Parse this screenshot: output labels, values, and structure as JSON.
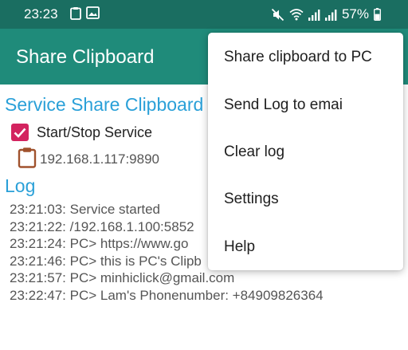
{
  "status_bar": {
    "time": "23:23",
    "battery": "57%",
    "icons": [
      "clipboard-icon",
      "image-icon",
      "mute-icon",
      "wifi-icon",
      "signal-icon",
      "signal-icon",
      "battery-icon"
    ]
  },
  "app_bar": {
    "title": "Share Clipboard"
  },
  "main": {
    "section_title": "Service Share Clipboard",
    "service_toggle": {
      "label": "Start/Stop Service",
      "checked": true
    },
    "ip_address": "192.168.1.117:9890",
    "log_title": "Log",
    "log_lines": [
      "23:21:03: Service started",
      "23:21:22: /192.168.1.100:5852",
      "23:21:24: PC> https://www.go",
      "23:21:46: PC> this is PC's Clipb",
      "23:21:57: PC> minhiclick@gmail.com",
      "23:22:47: PC> Lam's Phonenumber: +84909826364"
    ]
  },
  "overflow_menu": {
    "items": [
      "Share clipboard to PC",
      "Send Log to emai",
      "Clear log",
      "Settings",
      "Help"
    ]
  },
  "colors": {
    "status_bar": "#1a6e61",
    "app_bar": "#1f8b7a",
    "accent_text": "#2aa0d8",
    "checkbox": "#d3235f",
    "clipboard_icon": "#a0522d"
  }
}
